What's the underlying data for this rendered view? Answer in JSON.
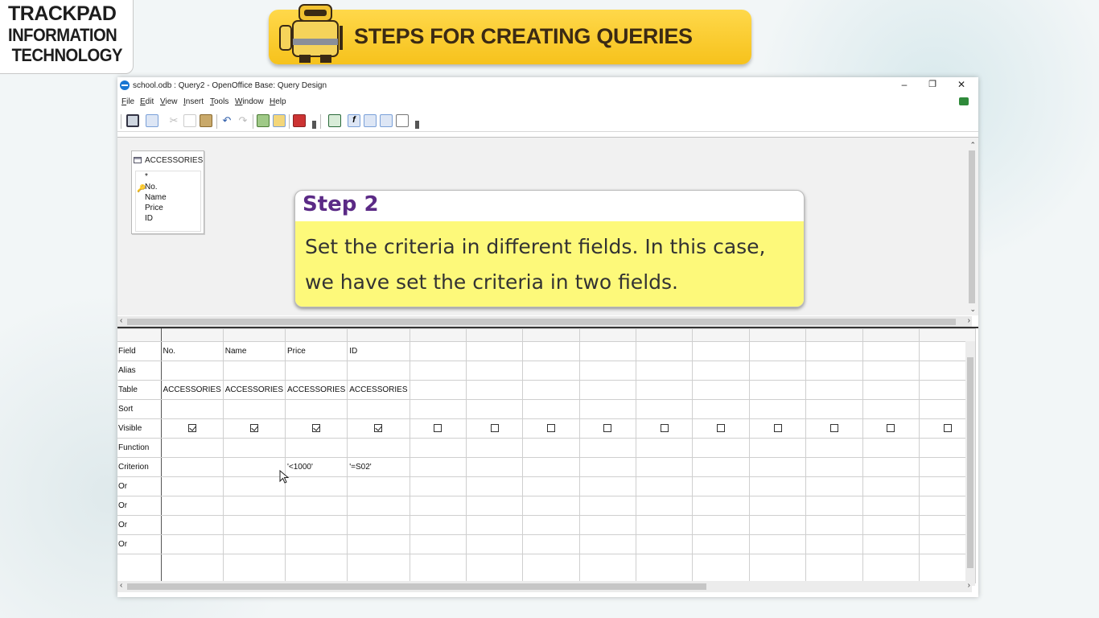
{
  "logo": {
    "line1": "TRACKPAD",
    "line2": "INFORMATION",
    "line3": "TECHNOLOGY"
  },
  "banner": {
    "title": "STEPS FOR CREATING QUERIES"
  },
  "window": {
    "title": "school.odb : Query2 - OpenOffice Base: Query Design",
    "controls": {
      "minimize": "–",
      "restore": "❐",
      "close": "✕"
    }
  },
  "menu": {
    "file": {
      "u": "F",
      "rest": "ile"
    },
    "edit": {
      "u": "E",
      "rest": "dit"
    },
    "view": {
      "u": "V",
      "rest": "iew"
    },
    "insert": {
      "u": "I",
      "rest": "nsert"
    },
    "tools": {
      "u": "T",
      "rest": "ools"
    },
    "window": {
      "u": "W",
      "rest": "indow"
    },
    "help": {
      "u": "H",
      "rest": "elp"
    }
  },
  "table_box": {
    "name": "ACCESSORIES",
    "fields": [
      "*",
      "No.",
      "Name",
      "Price",
      "ID"
    ]
  },
  "callout": {
    "title": "Step 2",
    "body_line1": "Set the criteria in different fields. In this case,",
    "body_line2": "we have set the criteria in two fields."
  },
  "grid": {
    "row_labels": {
      "field": "Field",
      "alias": "Alias",
      "table": "Table",
      "sort": "Sort",
      "visible": "Visible",
      "function": "Function",
      "criterion": "Criterion",
      "or1": "Or",
      "or2": "Or",
      "or3": "Or",
      "or4": "Or"
    },
    "columns": [
      {
        "field": "No.",
        "table": "ACCESSORIES",
        "visible": true,
        "criterion": ""
      },
      {
        "field": "Name",
        "table": "ACCESSORIES",
        "visible": true,
        "criterion": ""
      },
      {
        "field": "Price",
        "table": "ACCESSORIES",
        "visible": true,
        "criterion": "'<1000'"
      },
      {
        "field": "ID",
        "table": "ACCESSORIES",
        "visible": true,
        "criterion": "'=S02'"
      }
    ],
    "empty_columns": 10
  },
  "colors": {
    "banner": "#f6c21c",
    "callout_title": "#5b2a86",
    "callout_body": "#fdf97a"
  }
}
